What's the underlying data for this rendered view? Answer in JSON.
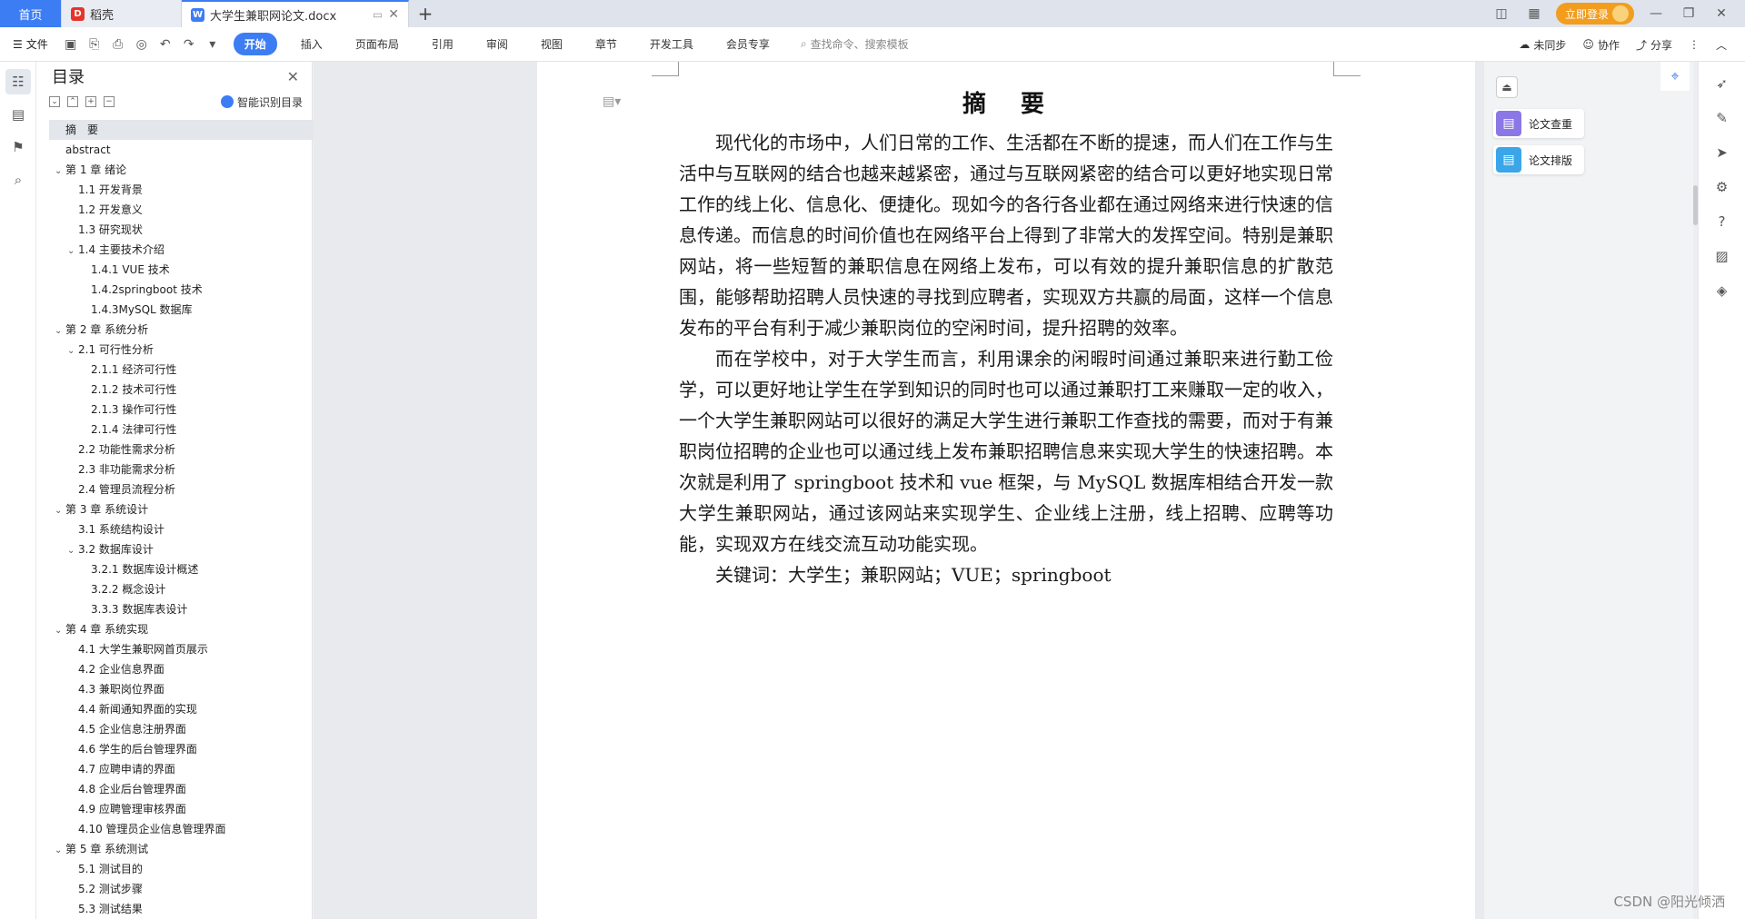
{
  "tabs": {
    "home": "首页",
    "doke": "稻壳",
    "doc": "大学生兼职网论文.docx",
    "new_tab": "+"
  },
  "titlebar": {
    "login": "立即登录"
  },
  "toolbar": {
    "file": "文件",
    "ribbon": [
      "开始",
      "插入",
      "页面布局",
      "引用",
      "审阅",
      "视图",
      "章节",
      "开发工具",
      "会员专享"
    ],
    "active": "开始",
    "search_placeholder": "查找命令、搜索模板",
    "sync": "未同步",
    "collab": "协作",
    "share": "分享"
  },
  "toc": {
    "title": "目录",
    "smart": "智能识别目录",
    "items": [
      {
        "text": "摘　要",
        "level": 0,
        "caret": "",
        "selected": true
      },
      {
        "text": "abstract",
        "level": 0,
        "caret": ""
      },
      {
        "text": "第 1 章  绪论",
        "level": 0,
        "caret": "v"
      },
      {
        "text": "1.1 开发背景",
        "level": 1,
        "caret": ""
      },
      {
        "text": "1.2 开发意义",
        "level": 1,
        "caret": ""
      },
      {
        "text": "1.3 研究现状",
        "level": 1,
        "caret": ""
      },
      {
        "text": "1.4 主要技术介绍",
        "level": 1,
        "caret": "v"
      },
      {
        "text": "1.4.1 VUE 技术",
        "level": 2,
        "caret": ""
      },
      {
        "text": "1.4.2springboot 技术",
        "level": 2,
        "caret": ""
      },
      {
        "text": "1.4.3MySQL 数据库",
        "level": 2,
        "caret": ""
      },
      {
        "text": "第 2 章  系统分析",
        "level": 0,
        "caret": "v"
      },
      {
        "text": "2.1 可行性分析",
        "level": 1,
        "caret": "v"
      },
      {
        "text": "2.1.1 经济可行性",
        "level": 2,
        "caret": ""
      },
      {
        "text": "2.1.2 技术可行性",
        "level": 2,
        "caret": ""
      },
      {
        "text": "2.1.3 操作可行性",
        "level": 2,
        "caret": ""
      },
      {
        "text": "2.1.4 法律可行性",
        "level": 2,
        "caret": ""
      },
      {
        "text": "2.2 功能性需求分析",
        "level": 1,
        "caret": ""
      },
      {
        "text": "2.3 非功能需求分析",
        "level": 1,
        "caret": ""
      },
      {
        "text": "2.4 管理员流程分析",
        "level": 1,
        "caret": ""
      },
      {
        "text": "第 3 章  系统设计",
        "level": 0,
        "caret": "v"
      },
      {
        "text": "3.1 系统结构设计",
        "level": 1,
        "caret": ""
      },
      {
        "text": "3.2 数据库设计",
        "level": 1,
        "caret": "v"
      },
      {
        "text": "3.2.1 数据库设计概述",
        "level": 2,
        "caret": ""
      },
      {
        "text": "3.2.2 概念设计",
        "level": 2,
        "caret": ""
      },
      {
        "text": "3.3.3 数据库表设计",
        "level": 2,
        "caret": ""
      },
      {
        "text": "第 4 章    系统实现",
        "level": 0,
        "caret": "v"
      },
      {
        "text": "4.1 大学生兼职网首页展示",
        "level": 1,
        "caret": ""
      },
      {
        "text": "4.2 企业信息界面",
        "level": 1,
        "caret": ""
      },
      {
        "text": "4.3 兼职岗位界面",
        "level": 1,
        "caret": ""
      },
      {
        "text": "4.4 新闻通知界面的实现",
        "level": 1,
        "caret": ""
      },
      {
        "text": "4.5 企业信息注册界面",
        "level": 1,
        "caret": ""
      },
      {
        "text": "4.6 学生的后台管理界面",
        "level": 1,
        "caret": ""
      },
      {
        "text": "4.7 应聘申请的界面",
        "level": 1,
        "caret": ""
      },
      {
        "text": "4.8 企业后台管理界面",
        "level": 1,
        "caret": ""
      },
      {
        "text": "4.9 应聘管理审核界面",
        "level": 1,
        "caret": ""
      },
      {
        "text": "4.10 管理员企业信息管理界面",
        "level": 1,
        "caret": ""
      },
      {
        "text": "第 5 章    系统测试",
        "level": 0,
        "caret": "v"
      },
      {
        "text": "5.1 测试目的",
        "level": 1,
        "caret": ""
      },
      {
        "text": "5.2 测试步骤",
        "level": 1,
        "caret": ""
      },
      {
        "text": "5.3 测试结果",
        "level": 1,
        "caret": ""
      }
    ]
  },
  "document": {
    "heading": "摘　要",
    "paragraphs": [
      "现代化的市场中，人们日常的工作、生活都在不断的提速，而人们在工作与生活中与互联网的结合也越来越紧密，通过与互联网紧密的结合可以更好地实现日常工作的线上化、信息化、便捷化。现如今的各行各业都在通过网络来进行快速的信息传递。而信息的时间价值也在网络平台上得到了非常大的发挥空间。特别是兼职网站，将一些短暂的兼职信息在网络上发布，可以有效的提升兼职信息的扩散范围，能够帮助招聘人员快速的寻找到应聘者，实现双方共赢的局面，这样一个信息发布的平台有利于减少兼职岗位的空闲时间，提升招聘的效率。",
      "而在学校中，对于大学生而言，利用课余的闲暇时间通过兼职来进行勤工俭学，可以更好地让学生在学到知识的同时也可以通过兼职打工来赚取一定的收入，一个大学生兼职网站可以很好的满足大学生进行兼职工作查找的需要，而对于有兼职岗位招聘的企业也可以通过线上发布兼职招聘信息来实现大学生的快速招聘。本次就是利用了 springboot 技术和 vue 框架，与 MySQL 数据库相结合开发一款大学生兼职网站，通过该网站来实现学生、企业线上注册，线上招聘、应聘等功能，实现双方在线交流互动功能实现。",
      "关键词：大学生；兼职网站；VUE；springboot"
    ]
  },
  "assistant": {
    "check": "论文查重",
    "format": "论文排版"
  },
  "watermark": "CSDN @阳光倾洒",
  "colors": {
    "accent": "#3d7df4",
    "login": "#f29d1e",
    "check_icon": "#8b78e6",
    "format_icon": "#3aa6e8"
  }
}
